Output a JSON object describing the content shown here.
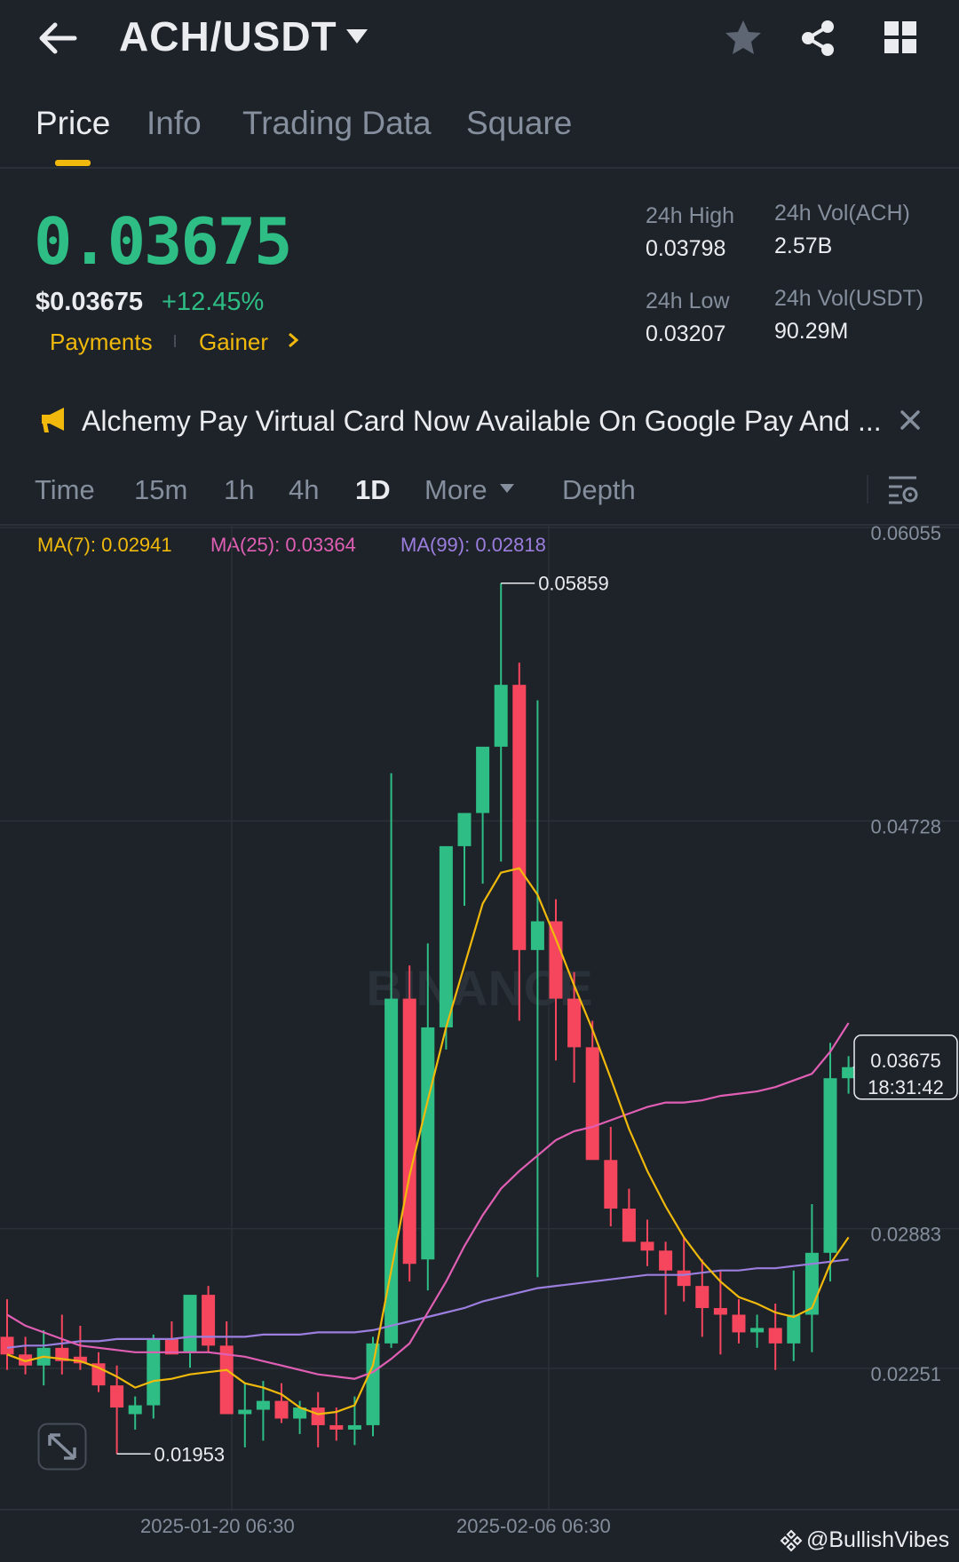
{
  "header": {
    "pair": "ACH/USDT",
    "icons": {
      "back": "arrow-left-icon",
      "pair_menu": "caret-down-icon",
      "favorite": "star-icon",
      "share": "share-icon",
      "more": "grid-icon"
    }
  },
  "tabs": [
    {
      "label": "Price",
      "active": true
    },
    {
      "label": "Info",
      "active": false
    },
    {
      "label": "Trading Data",
      "active": false
    },
    {
      "label": "Square",
      "active": false
    }
  ],
  "price": {
    "last": "0.03675",
    "usd": "$0.03675",
    "change": "+12.45%",
    "tags": [
      "Payments",
      "Gainer"
    ]
  },
  "stats": {
    "high_label": "24h High",
    "high": "0.03798",
    "low_label": "24h Low",
    "low": "0.03207",
    "vol_ach_label": "24h Vol(ACH)",
    "vol_ach": "2.57B",
    "vol_usdt_label": "24h Vol(USDT)",
    "vol_usdt": "90.29M"
  },
  "news": {
    "icon": "megaphone-icon",
    "text": "Alchemy Pay Virtual Card Now Available On Google Pay And ...",
    "close_icon": "close-icon"
  },
  "intervals": {
    "time": "Time",
    "m15": "15m",
    "h1": "1h",
    "h4": "4h",
    "d1": "1D",
    "more": "More",
    "depth": "Depth",
    "active": "1D",
    "settings_icon": "chart-settings-icon"
  },
  "ma": {
    "ma7": "MA(7): 0.02941",
    "ma25": "MA(25): 0.03364",
    "ma99": "MA(99): 0.02818",
    "colors": {
      "ma7": "#f0b90b",
      "ma25": "#e05fb4",
      "ma99": "#9b7ede"
    }
  },
  "chart_data": {
    "type": "candlestick",
    "y_ticks": [
      "0.06055",
      "0.04728",
      "0.02883",
      "0.02251"
    ],
    "y_tick_values": [
      0.06055,
      0.04728,
      0.02883,
      0.02251
    ],
    "ylim": [
      0.0166,
      0.0612
    ],
    "x_ticks": [
      "2025-01-20 06:30",
      "2025-02-06 06:30"
    ],
    "current_price": "0.03675",
    "countdown": "18:31:42",
    "high_marker": "0.05859",
    "low_marker": "0.01953",
    "colors": {
      "up": "#2ebd85",
      "down": "#f6465d"
    },
    "candles": [
      {
        "o": 0.0245,
        "h": 0.0262,
        "l": 0.023,
        "c": 0.0237
      },
      {
        "o": 0.0237,
        "h": 0.0245,
        "l": 0.0228,
        "c": 0.0232
      },
      {
        "o": 0.0232,
        "h": 0.0248,
        "l": 0.0223,
        "c": 0.024
      },
      {
        "o": 0.024,
        "h": 0.0255,
        "l": 0.0228,
        "c": 0.0234
      },
      {
        "o": 0.0236,
        "h": 0.025,
        "l": 0.023,
        "c": 0.0233
      },
      {
        "o": 0.0233,
        "h": 0.0238,
        "l": 0.022,
        "c": 0.0223
      },
      {
        "o": 0.0223,
        "h": 0.0232,
        "l": 0.0192,
        "c": 0.0213
      },
      {
        "o": 0.021,
        "h": 0.0218,
        "l": 0.0203,
        "c": 0.0214
      },
      {
        "o": 0.0214,
        "h": 0.0246,
        "l": 0.0208,
        "c": 0.0244
      },
      {
        "o": 0.0244,
        "h": 0.0252,
        "l": 0.0238,
        "c": 0.0237
      },
      {
        "o": 0.0238,
        "h": 0.0262,
        "l": 0.0231,
        "c": 0.0264
      },
      {
        "o": 0.0264,
        "h": 0.0268,
        "l": 0.0238,
        "c": 0.0241
      },
      {
        "o": 0.0241,
        "h": 0.0252,
        "l": 0.021,
        "c": 0.021
      },
      {
        "o": 0.021,
        "h": 0.0224,
        "l": 0.0195,
        "c": 0.0212
      },
      {
        "o": 0.0212,
        "h": 0.0225,
        "l": 0.0198,
        "c": 0.0216
      },
      {
        "o": 0.0216,
        "h": 0.0224,
        "l": 0.0206,
        "c": 0.0208
      },
      {
        "o": 0.0208,
        "h": 0.0216,
        "l": 0.0201,
        "c": 0.0213
      },
      {
        "o": 0.0213,
        "h": 0.022,
        "l": 0.0195,
        "c": 0.0205
      },
      {
        "o": 0.0205,
        "h": 0.0213,
        "l": 0.0198,
        "c": 0.0203
      },
      {
        "o": 0.0203,
        "h": 0.0218,
        "l": 0.0196,
        "c": 0.0205
      },
      {
        "o": 0.0205,
        "h": 0.0245,
        "l": 0.02,
        "c": 0.0242
      },
      {
        "o": 0.0242,
        "h": 0.05,
        "l": 0.024,
        "c": 0.0398
      },
      {
        "o": 0.0398,
        "h": 0.0413,
        "l": 0.027,
        "c": 0.0278
      },
      {
        "o": 0.028,
        "h": 0.0423,
        "l": 0.0266,
        "c": 0.0385
      },
      {
        "o": 0.0385,
        "h": 0.0455,
        "l": 0.0375,
        "c": 0.0467
      },
      {
        "o": 0.0467,
        "h": 0.0482,
        "l": 0.044,
        "c": 0.0482
      },
      {
        "o": 0.0482,
        "h": 0.051,
        "l": 0.045,
        "c": 0.0512
      },
      {
        "o": 0.0512,
        "h": 0.0586,
        "l": 0.046,
        "c": 0.054
      },
      {
        "o": 0.054,
        "h": 0.055,
        "l": 0.0388,
        "c": 0.042
      },
      {
        "o": 0.042,
        "h": 0.0533,
        "l": 0.0272,
        "c": 0.0433
      },
      {
        "o": 0.0433,
        "h": 0.0443,
        "l": 0.037,
        "c": 0.0398
      },
      {
        "o": 0.0398,
        "h": 0.041,
        "l": 0.036,
        "c": 0.0376
      },
      {
        "o": 0.0376,
        "h": 0.0388,
        "l": 0.034,
        "c": 0.0325
      },
      {
        "o": 0.0325,
        "h": 0.034,
        "l": 0.0295,
        "c": 0.0303
      },
      {
        "o": 0.0303,
        "h": 0.0312,
        "l": 0.0289,
        "c": 0.0288
      },
      {
        "o": 0.0288,
        "h": 0.0298,
        "l": 0.0277,
        "c": 0.0284
      },
      {
        "o": 0.0284,
        "h": 0.0288,
        "l": 0.0255,
        "c": 0.0275
      },
      {
        "o": 0.0275,
        "h": 0.029,
        "l": 0.0261,
        "c": 0.0268
      },
      {
        "o": 0.0268,
        "h": 0.028,
        "l": 0.0245,
        "c": 0.0258
      },
      {
        "o": 0.0258,
        "h": 0.0275,
        "l": 0.0237,
        "c": 0.0255
      },
      {
        "o": 0.0255,
        "h": 0.0262,
        "l": 0.0242,
        "c": 0.0247
      },
      {
        "o": 0.0247,
        "h": 0.0255,
        "l": 0.024,
        "c": 0.0249
      },
      {
        "o": 0.0249,
        "h": 0.026,
        "l": 0.023,
        "c": 0.0242
      },
      {
        "o": 0.0242,
        "h": 0.0275,
        "l": 0.0234,
        "c": 0.0255
      },
      {
        "o": 0.0255,
        "h": 0.0305,
        "l": 0.0238,
        "c": 0.0283
      },
      {
        "o": 0.0283,
        "h": 0.0378,
        "l": 0.027,
        "c": 0.0362
      },
      {
        "o": 0.0362,
        "h": 0.0372,
        "l": 0.0355,
        "c": 0.0367
      }
    ],
    "ma7": [
      0.0237,
      0.0234,
      0.0236,
      0.0235,
      0.0234,
      0.0231,
      0.0227,
      0.0222,
      0.0225,
      0.0226,
      0.0228,
      0.0229,
      0.023,
      0.0224,
      0.0222,
      0.0219,
      0.0213,
      0.021,
      0.0211,
      0.0214,
      0.0232,
      0.0275,
      0.0318,
      0.0352,
      0.0385,
      0.0413,
      0.0441,
      0.0455,
      0.0457,
      0.0445,
      0.0425,
      0.0404,
      0.0384,
      0.0362,
      0.0339,
      0.032,
      0.0304,
      0.029,
      0.0279,
      0.027,
      0.0263,
      0.026,
      0.0256,
      0.0254,
      0.0258,
      0.0278,
      0.029
    ],
    "ma25": [
      0.0255,
      0.025,
      0.0247,
      0.0244,
      0.0241,
      0.024,
      0.0239,
      0.0238,
      0.0238,
      0.0238,
      0.0238,
      0.0238,
      0.0237,
      0.0236,
      0.0234,
      0.0232,
      0.023,
      0.0228,
      0.0227,
      0.0226,
      0.0229,
      0.0235,
      0.0242,
      0.0256,
      0.027,
      0.0286,
      0.03,
      0.0312,
      0.032,
      0.0327,
      0.0334,
      0.0338,
      0.034,
      0.0343,
      0.0346,
      0.0349,
      0.0351,
      0.0351,
      0.0352,
      0.0354,
      0.0355,
      0.0356,
      0.0358,
      0.0361,
      0.0364,
      0.0374,
      0.0387
    ],
    "ma99": [
      0.024,
      0.0241,
      0.0241,
      0.0242,
      0.0243,
      0.0243,
      0.0244,
      0.0244,
      0.0244,
      0.0244,
      0.0245,
      0.0245,
      0.0245,
      0.0245,
      0.0246,
      0.0246,
      0.0246,
      0.0247,
      0.0247,
      0.0247,
      0.0248,
      0.025,
      0.0252,
      0.0254,
      0.0256,
      0.0258,
      0.0261,
      0.0263,
      0.0265,
      0.0267,
      0.0268,
      0.0269,
      0.027,
      0.0271,
      0.0272,
      0.0273,
      0.0273,
      0.0273,
      0.0274,
      0.0275,
      0.0275,
      0.0276,
      0.0276,
      0.0277,
      0.0278,
      0.0279,
      0.028
    ]
  },
  "watermark": {
    "brand": "BINANCE",
    "handle": "@BullishVibes"
  },
  "expand_icon": "expand-icon"
}
